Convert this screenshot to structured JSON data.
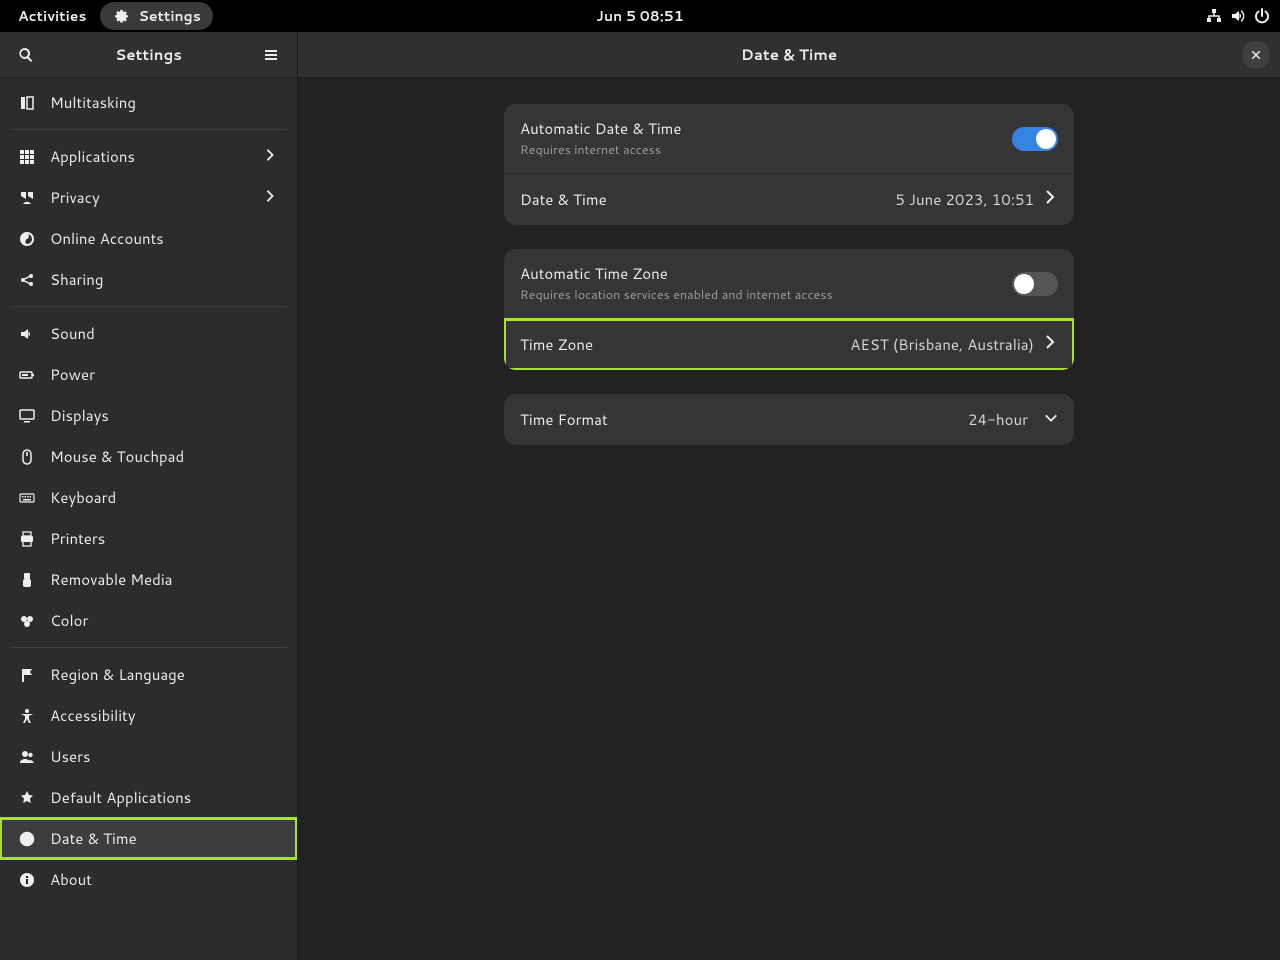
{
  "topbar": {
    "activities": "Activities",
    "app_label": "Settings",
    "clock": "Jun 5  08:51"
  },
  "sidebar": {
    "title": "Settings",
    "items": [
      {
        "icon": "multitasking",
        "label": "Multitasking",
        "chevron": false,
        "sep_after": true
      },
      {
        "icon": "apps",
        "label": "Applications",
        "chevron": true
      },
      {
        "icon": "privacy",
        "label": "Privacy",
        "chevron": true
      },
      {
        "icon": "online",
        "label": "Online Accounts"
      },
      {
        "icon": "sharing",
        "label": "Sharing",
        "sep_after": true
      },
      {
        "icon": "sound",
        "label": "Sound"
      },
      {
        "icon": "power",
        "label": "Power"
      },
      {
        "icon": "displays",
        "label": "Displays"
      },
      {
        "icon": "mouse",
        "label": "Mouse & Touchpad"
      },
      {
        "icon": "keyboard",
        "label": "Keyboard"
      },
      {
        "icon": "printers",
        "label": "Printers"
      },
      {
        "icon": "removable",
        "label": "Removable Media"
      },
      {
        "icon": "color",
        "label": "Color",
        "sep_after": true
      },
      {
        "icon": "region",
        "label": "Region & Language"
      },
      {
        "icon": "accessibility",
        "label": "Accessibility"
      },
      {
        "icon": "users",
        "label": "Users"
      },
      {
        "icon": "default",
        "label": "Default Applications"
      },
      {
        "icon": "datetime",
        "label": "Date & Time",
        "active": true,
        "highlight": true
      },
      {
        "icon": "about",
        "label": "About"
      }
    ]
  },
  "main": {
    "title": "Date & Time",
    "auto_datetime": {
      "title": "Automatic Date & Time",
      "subtitle": "Requires internet access",
      "on": true
    },
    "datetime": {
      "title": "Date & Time",
      "value": "5 June 2023, 10:51"
    },
    "auto_timezone": {
      "title": "Automatic Time Zone",
      "subtitle": "Requires location services enabled and internet access",
      "on": false
    },
    "timezone": {
      "title": "Time Zone",
      "value": "AEST (Brisbane, Australia)",
      "highlight": true
    },
    "timeformat": {
      "title": "Time Format",
      "value": "24-hour"
    }
  }
}
